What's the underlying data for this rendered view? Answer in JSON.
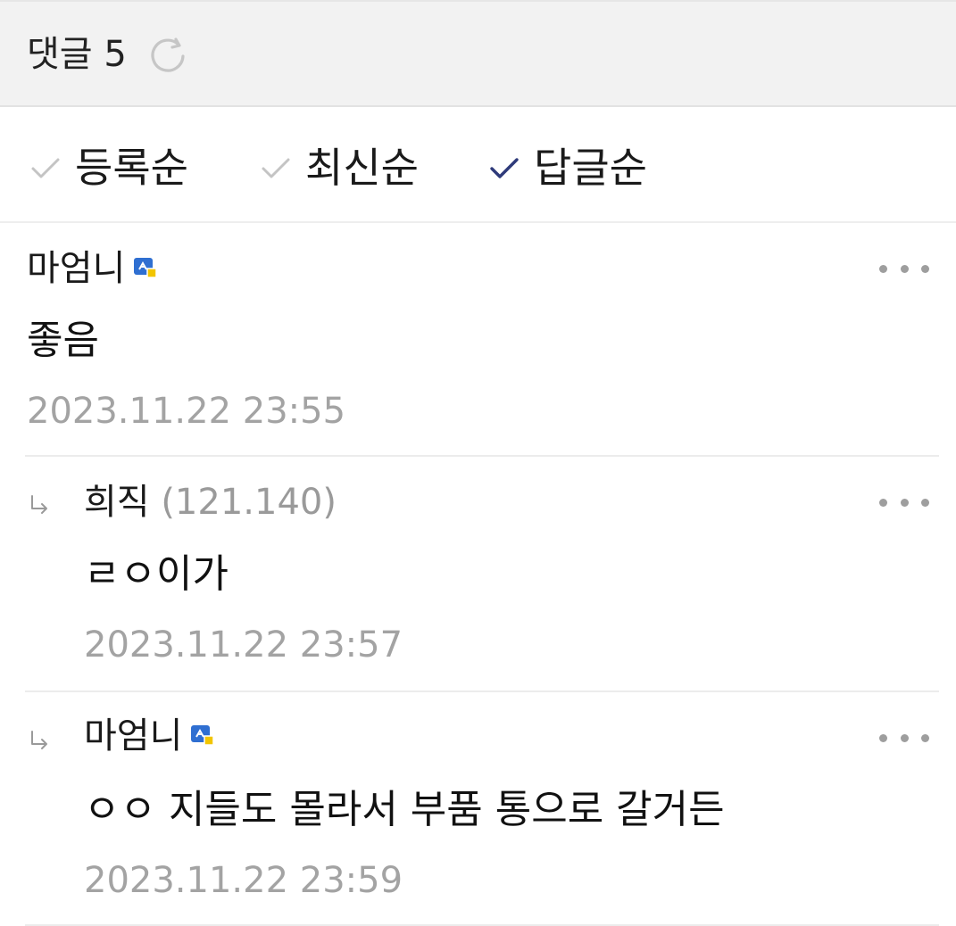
{
  "header": {
    "label": "댓글",
    "count": "5",
    "refresh_icon": "refresh-icon"
  },
  "sort": {
    "options": [
      {
        "label": "등록순",
        "selected": false
      },
      {
        "label": "최신순",
        "selected": false
      },
      {
        "label": "답글순",
        "selected": true
      }
    ],
    "selected_color": "#2e3a7a",
    "unselected_color": "#c4c4c4"
  },
  "comments": [
    {
      "author": "마엄니",
      "ip": "",
      "has_badge": true,
      "text": "좋음",
      "date": "2023.11.22 23:55",
      "is_reply": false
    },
    {
      "author": "희직",
      "ip": "(121.140)",
      "has_badge": false,
      "text": "ㄹㅇ이가",
      "date": "2023.11.22 23:57",
      "is_reply": true
    },
    {
      "author": "마엄니",
      "ip": "",
      "has_badge": true,
      "text": "ㅇㅇ 지들도 몰라서 부품 통으로 갈거든",
      "date": "2023.11.22 23:59",
      "is_reply": true
    }
  ]
}
